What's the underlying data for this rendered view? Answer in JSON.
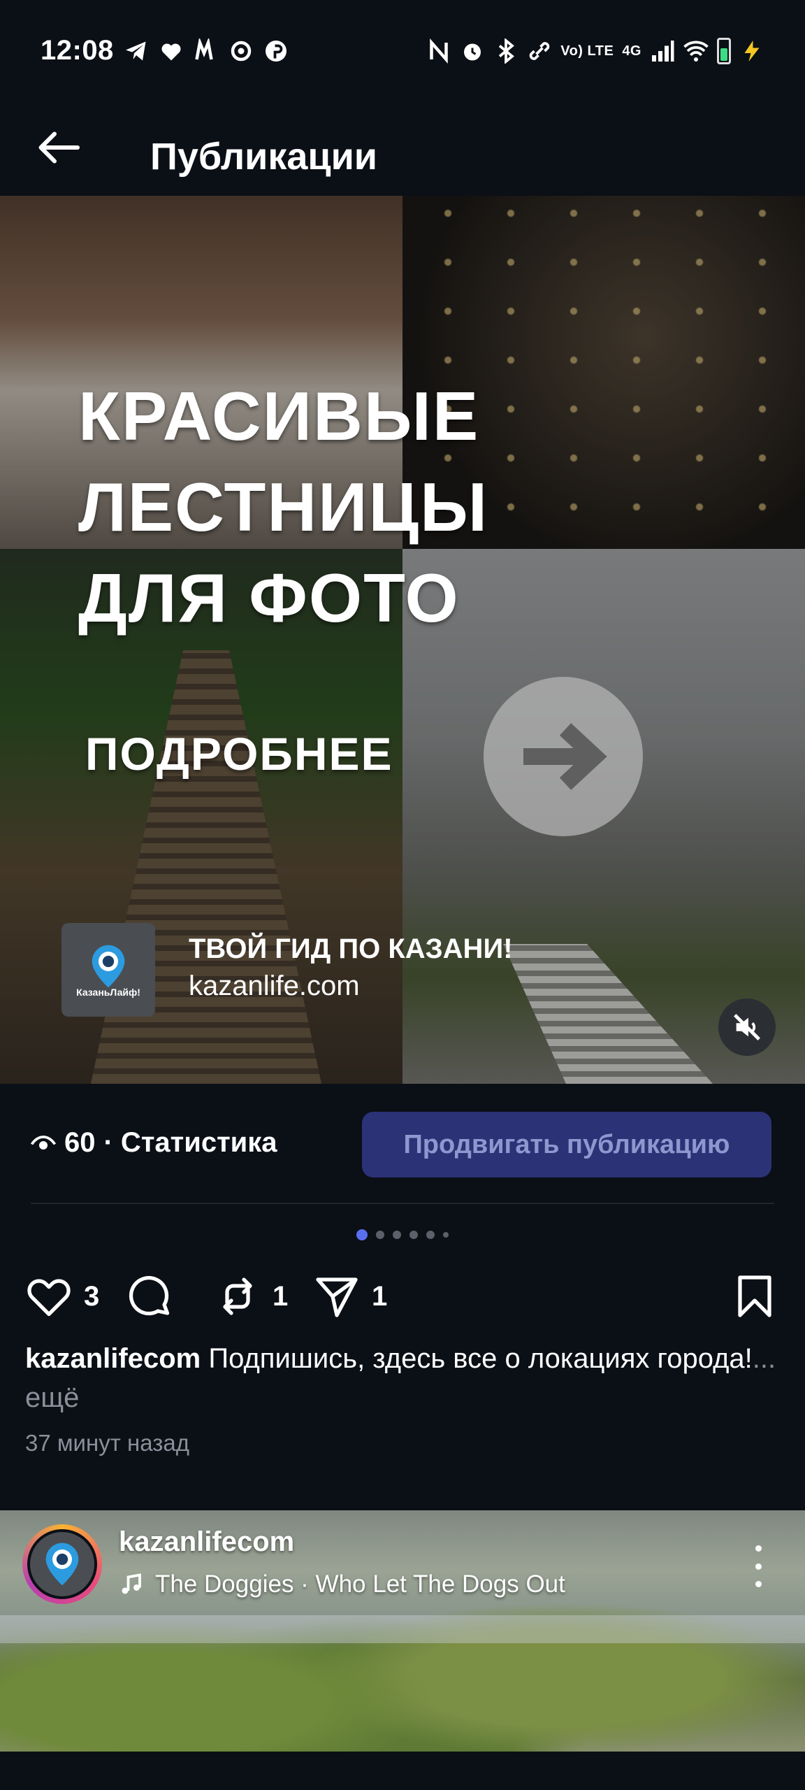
{
  "status_bar": {
    "time": "12:08",
    "network_label_top": "Vo) LTE",
    "network_label_4g": "4G",
    "icons": [
      "telegram-icon",
      "heart-icon",
      "mm-icon",
      "threads-icon",
      "pinterest-icon",
      "nfc-icon",
      "alarm-icon",
      "bluetooth-icon",
      "link-icon",
      "signal-icon",
      "wifi-icon",
      "battery-icon",
      "charging-icon"
    ]
  },
  "header": {
    "title": "Публикации"
  },
  "post": {
    "headline_line1": "КРАСИВЫЕ",
    "headline_line2": "ЛЕСТНИЦЫ",
    "headline_line3": "ДЛЯ ФОТО",
    "more_label": "ПОДРОБНЕЕ",
    "logo_text": "КазаньЛайф!",
    "tagline": "ТВОЙ ГИД ПО КАЗАНИ!",
    "site": "kazanlife.com",
    "views": "60",
    "stats_label": "· Статистика",
    "promote_label": "Продвигать публикацию",
    "likes": "3",
    "reposts": "1",
    "shares": "1",
    "caption_user": "kazanlifecom",
    "caption_text": " Подпишись, здесь все о локациях города!",
    "caption_more": "... ещё",
    "time_ago": "37 минут назад"
  },
  "pager": {
    "count": 6,
    "active": 0
  },
  "next_post": {
    "username": "kazanlifecom",
    "music": "The Doggies · Who Let The Dogs Out"
  },
  "colors": {
    "background": "#0b0f16",
    "promote_bg": "#2b3276",
    "promote_text": "#8f97cf",
    "pager_active": "#5a6ff0",
    "muted_text": "#8a8f99"
  }
}
